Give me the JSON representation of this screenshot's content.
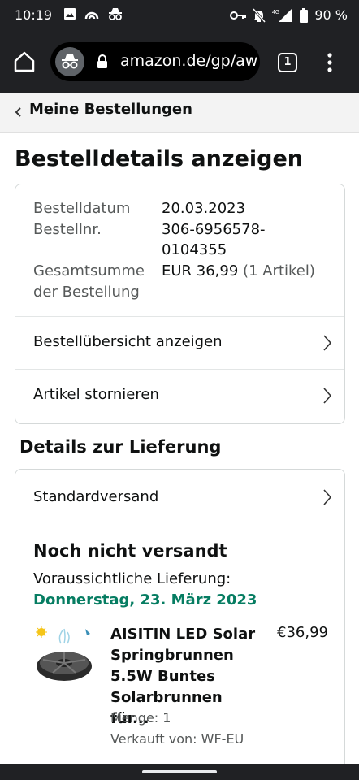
{
  "status_bar": {
    "time": "10:19",
    "battery": "90 %",
    "network": "4G",
    "icons_left": [
      "image-icon",
      "hotspot-icon",
      "incognito-icon"
    ],
    "icons_right": [
      "vpn-key-icon",
      "mute-icon",
      "signal-icon",
      "battery-icon"
    ]
  },
  "browser": {
    "url": "amazon.de/gp/aw",
    "tab_count": "1"
  },
  "breadcrumb": {
    "label": "Meine Bestellungen"
  },
  "page": {
    "title": "Bestelldetails anzeigen"
  },
  "order_info": {
    "date_label": "Bestelldatum",
    "date_value": "20.03.2023",
    "number_label": "Bestellnr.",
    "number_value_line1": "306-6956578-",
    "number_value_line2": "0104355",
    "total_label_line1": "Gesamtsumme",
    "total_label_line2": "der Bestellung",
    "total_value": "EUR 36,99",
    "total_items": "(1 Artikel)",
    "summary_link": "Bestellübersicht anzeigen",
    "cancel_link": "Artikel stornieren"
  },
  "delivery": {
    "section_title": "Details zur Lieferung",
    "shipping_method": "Standardversand",
    "status": "Noch nicht versandt",
    "expected_label": "Voraussichtliche Lieferung:",
    "expected_date": "Donnerstag, 23. März 2023",
    "expected_date_color": "#067d62"
  },
  "product": {
    "title_line1": "AISITIN LED Solar",
    "title_line2": "Springbrunnen",
    "title_line3": "5.5W Buntes",
    "title_line4": "Solarbrunnen für...",
    "price": "€36,99",
    "quantity": "Menge: 1",
    "seller": "Verkauft von: WF-EU"
  }
}
